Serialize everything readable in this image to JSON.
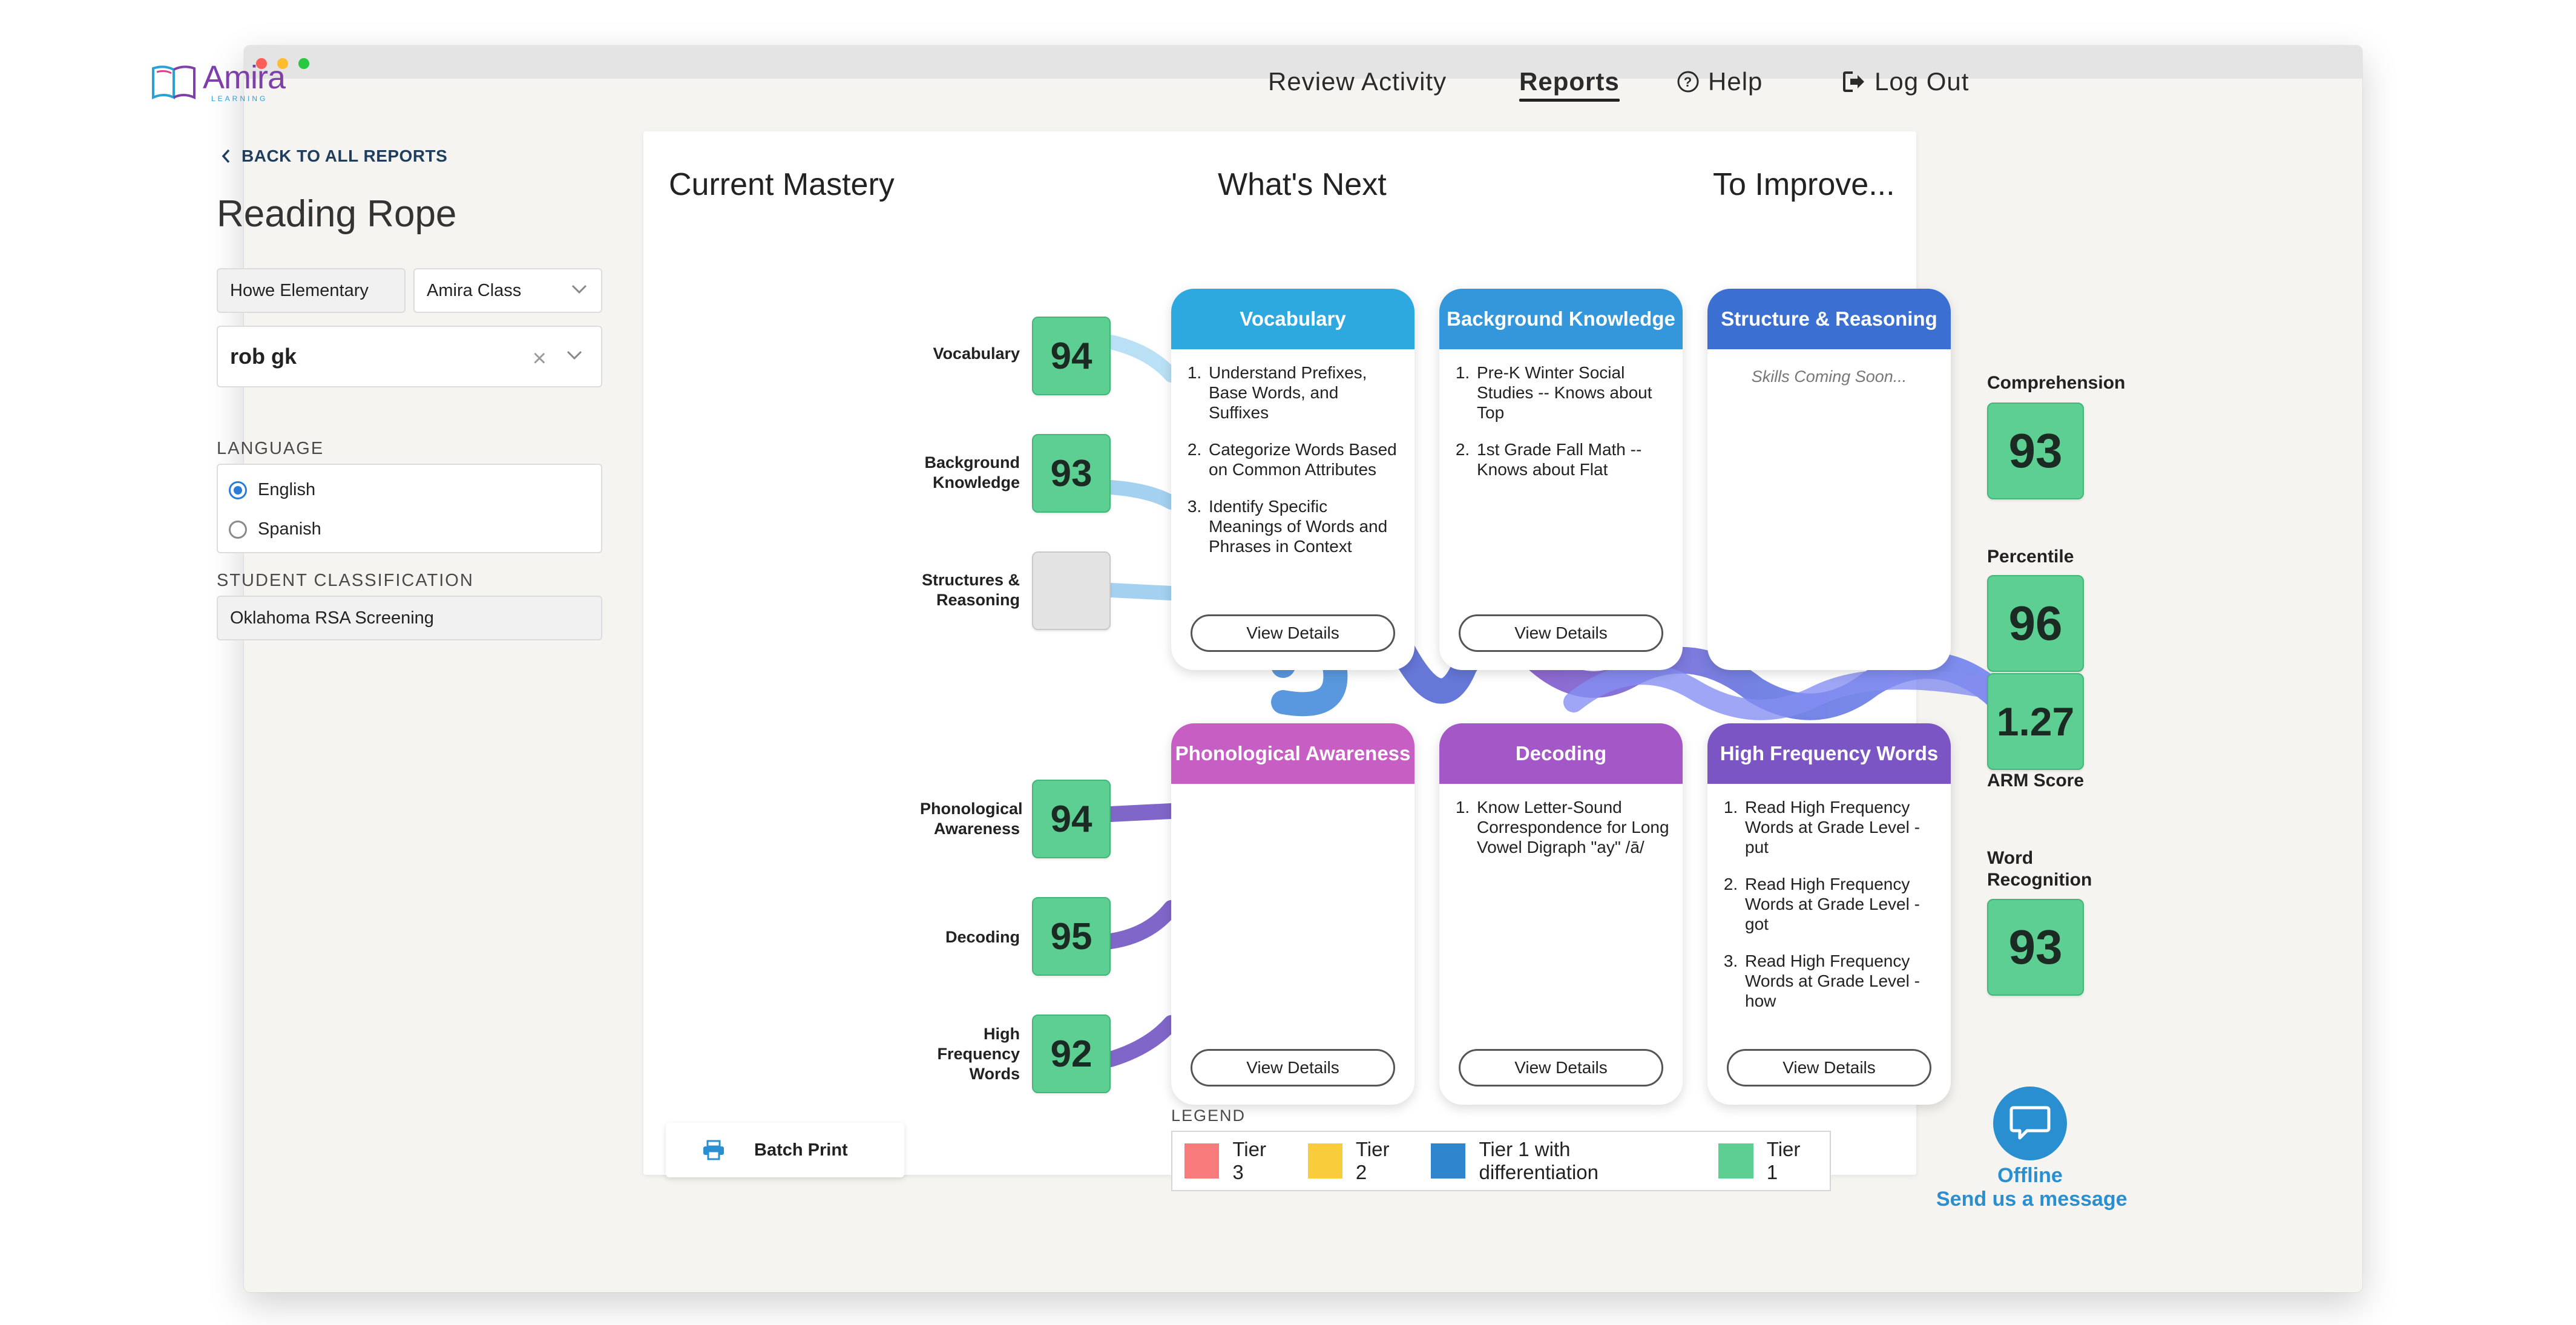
{
  "header": {
    "logo_text": "Amira",
    "logo_sub": "LEARNING",
    "nav": {
      "review": "Review Activity",
      "reports": "Reports",
      "help": "Help",
      "logout": "Log Out"
    }
  },
  "sidebar": {
    "back_link": "BACK TO ALL REPORTS",
    "title": "Reading Rope",
    "school": "Howe Elementary",
    "class": "Amira Class",
    "student": "rob gk",
    "clear_symbol": "×",
    "language_label": "LANGUAGE",
    "languages": [
      {
        "label": "English",
        "selected": true
      },
      {
        "label": "Spanish",
        "selected": false
      }
    ],
    "classification_label": "STUDENT CLASSIFICATION",
    "classification": "Oklahoma RSA Screening"
  },
  "columns": {
    "current": "Current Mastery",
    "next": "What's Next",
    "improve": "To Improve..."
  },
  "mastery": [
    {
      "label": "Vocabulary",
      "score": "94"
    },
    {
      "label": "Background Knowledge",
      "score": "93"
    },
    {
      "label": "Structures & Reasoning",
      "score": ""
    },
    {
      "label": "Phonological Awareness",
      "score": "94"
    },
    {
      "label": "Decoding",
      "score": "95"
    },
    {
      "label": "High Frequency Words",
      "score": "92"
    }
  ],
  "tiles": [
    {
      "title": "Vocabulary",
      "color": "#2ea9df",
      "items": [
        "Understand Prefixes, Base Words, and Suffixes",
        "Categorize Words Based on Common Attributes",
        "Identify Specific Meanings of Words and Phrases in Context"
      ],
      "button": "View Details"
    },
    {
      "title": "Background Knowledge",
      "color": "#3597db",
      "items": [
        "Pre-K Winter Social Studies -- Knows about Top",
        "1st Grade Fall Math -- Knows about Flat"
      ],
      "button": "View Details"
    },
    {
      "title": "Structure & Reasoning",
      "color": "#3c6fd2",
      "items": [],
      "note": "Skills Coming Soon..."
    },
    {
      "title": "Phonological Awareness",
      "color": "#c65ec4",
      "items": [],
      "button": "View Details"
    },
    {
      "title": "Decoding",
      "color": "#a457c6",
      "items": [
        "Know Letter-Sound Correspondence for Long Vowel Digraph \"ay\" /ā/"
      ],
      "button": "View Details"
    },
    {
      "title": "High Frequency Words",
      "color": "#7c55c4",
      "items": [
        "Read High Frequency Words at Grade Level - put",
        "Read High Frequency Words at Grade Level - got",
        "Read High Frequency Words at Grade Level - how"
      ],
      "button": "View Details"
    }
  ],
  "outcomes": {
    "comprehension_label": "Comprehension",
    "comprehension": "93",
    "percentile_label": "Percentile",
    "percentile": "96",
    "arm_score": "1.27",
    "arm_label": "ARM Score",
    "word_recognition_label": "Word Recognition",
    "word_recognition": "93"
  },
  "batch_print": "Batch Print",
  "legend": {
    "label": "LEGEND",
    "items": [
      {
        "label": "Tier 3",
        "color": "#f77b7b"
      },
      {
        "label": "Tier 2",
        "color": "#f8cc3a"
      },
      {
        "label": "Tier 1 with differentiation",
        "color": "#2f86cf"
      },
      {
        "label": "Tier 1",
        "color": "#5dcf92"
      }
    ]
  },
  "chat": {
    "status": "Offline",
    "message": "Send us a message"
  }
}
